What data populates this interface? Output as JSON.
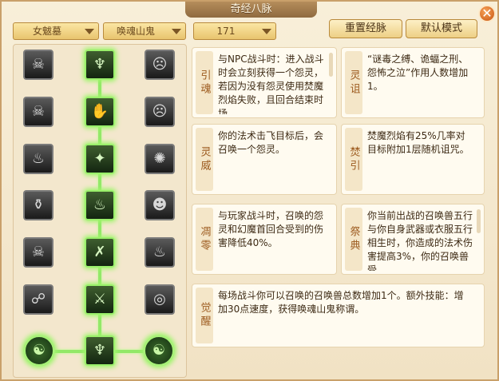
{
  "window": {
    "title": "奇经八脉"
  },
  "close_icon": "✕",
  "filters": {
    "school": "女魃墓",
    "branch": "唤魂山鬼",
    "level": "171"
  },
  "actions": {
    "reset_label": "重置经脉",
    "default_label": "默认模式"
  },
  "skill_icons": {
    "left": [
      "☠",
      "☠",
      "♨",
      "⚱",
      "☠",
      "☍"
    ],
    "center": [
      "♆",
      "✋",
      "✦",
      "♨",
      "✗",
      "⚔",
      "♆"
    ],
    "right": [
      "☹",
      "☹",
      "✺",
      "☻",
      "♨",
      "◎"
    ],
    "bottom_left": "☯",
    "bottom_right": "☯"
  },
  "cards": [
    {
      "label": "引魂",
      "text": "与NPC战斗时：进入战斗时会立刻获得一个怨灵，若因为没有怨灵使用焚魔烈焰失败，且回合结束时场"
    },
    {
      "label": "灵诅",
      "text": "“谜毒之缚、诡蝠之刑、怨怖之泣”作用人数增加1。"
    },
    {
      "label": "灵威",
      "text": "你的法术击飞目标后，会召唤一个怨灵。"
    },
    {
      "label": "焚引",
      "text": "焚魔烈焰有25%几率对目标附加1层随机诅咒。"
    },
    {
      "label": "凋零",
      "text": "与玩家战斗时，召唤的怨灵和幻魔首回合受到的伤害降低40%。"
    },
    {
      "label": "祭典",
      "text": "你当前出战的召唤兽五行与你自身武器或衣服五行相生时，你造成的法术伤害提高3%，你的召唤兽受"
    },
    {
      "label": "觉醒",
      "text": "每场战斗你可以召唤的召唤兽总数增加1个。额外技能：增加30点速度，获得唤魂山鬼称谓。"
    }
  ]
}
